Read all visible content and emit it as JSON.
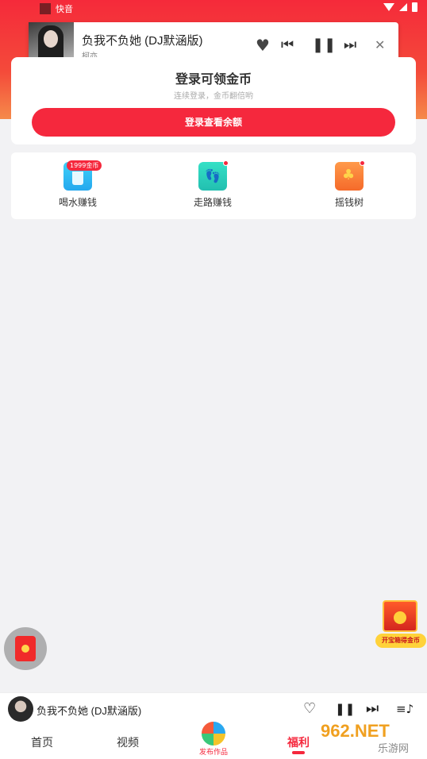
{
  "status_bar": {
    "app_name": "快音"
  },
  "notification": {
    "song_title": "负我不负她 (DJ默涵版)",
    "artist": "柯亦",
    "controls": [
      "heart-icon",
      "previous-icon",
      "pause-icon",
      "next-icon",
      "close-icon"
    ],
    "like_icon": "♥",
    "prev_icon": "⏮",
    "pause_icon": "❚❚",
    "next_icon": "⏭",
    "close_icon": "✕"
  },
  "login_card": {
    "title": "登录可领金币",
    "subtitle": "连续登录，金币翻倍哟",
    "button_label": "登录查看余额"
  },
  "earn_items": [
    {
      "label": "喝水赚钱",
      "badge": "1999金币",
      "icon": "water-cup-icon"
    },
    {
      "label": "走路赚钱",
      "icon": "footprints-icon"
    },
    {
      "label": "摇钱树",
      "icon": "money-tree-icon"
    }
  ],
  "floating": {
    "chest_label": "开宝箱得金币"
  },
  "mini_player": {
    "song_title": "负我不负她 (DJ默涵版)",
    "heart_icon": "♡",
    "pause_icon": "❚❚",
    "next_icon": "⏭",
    "playlist_icon": "≡♪"
  },
  "tabs": [
    {
      "label": "首页",
      "active": false
    },
    {
      "label": "视频",
      "active": false
    },
    {
      "label": "发布作品",
      "active": false
    },
    {
      "label": "福利",
      "active": true
    }
  ],
  "watermark": {
    "top": "962.NET",
    "bottom": "乐游网"
  },
  "colors": {
    "accent": "#f5283d",
    "header_gradient_start": "#f52a3a",
    "header_gradient_end": "#f58a4a"
  }
}
